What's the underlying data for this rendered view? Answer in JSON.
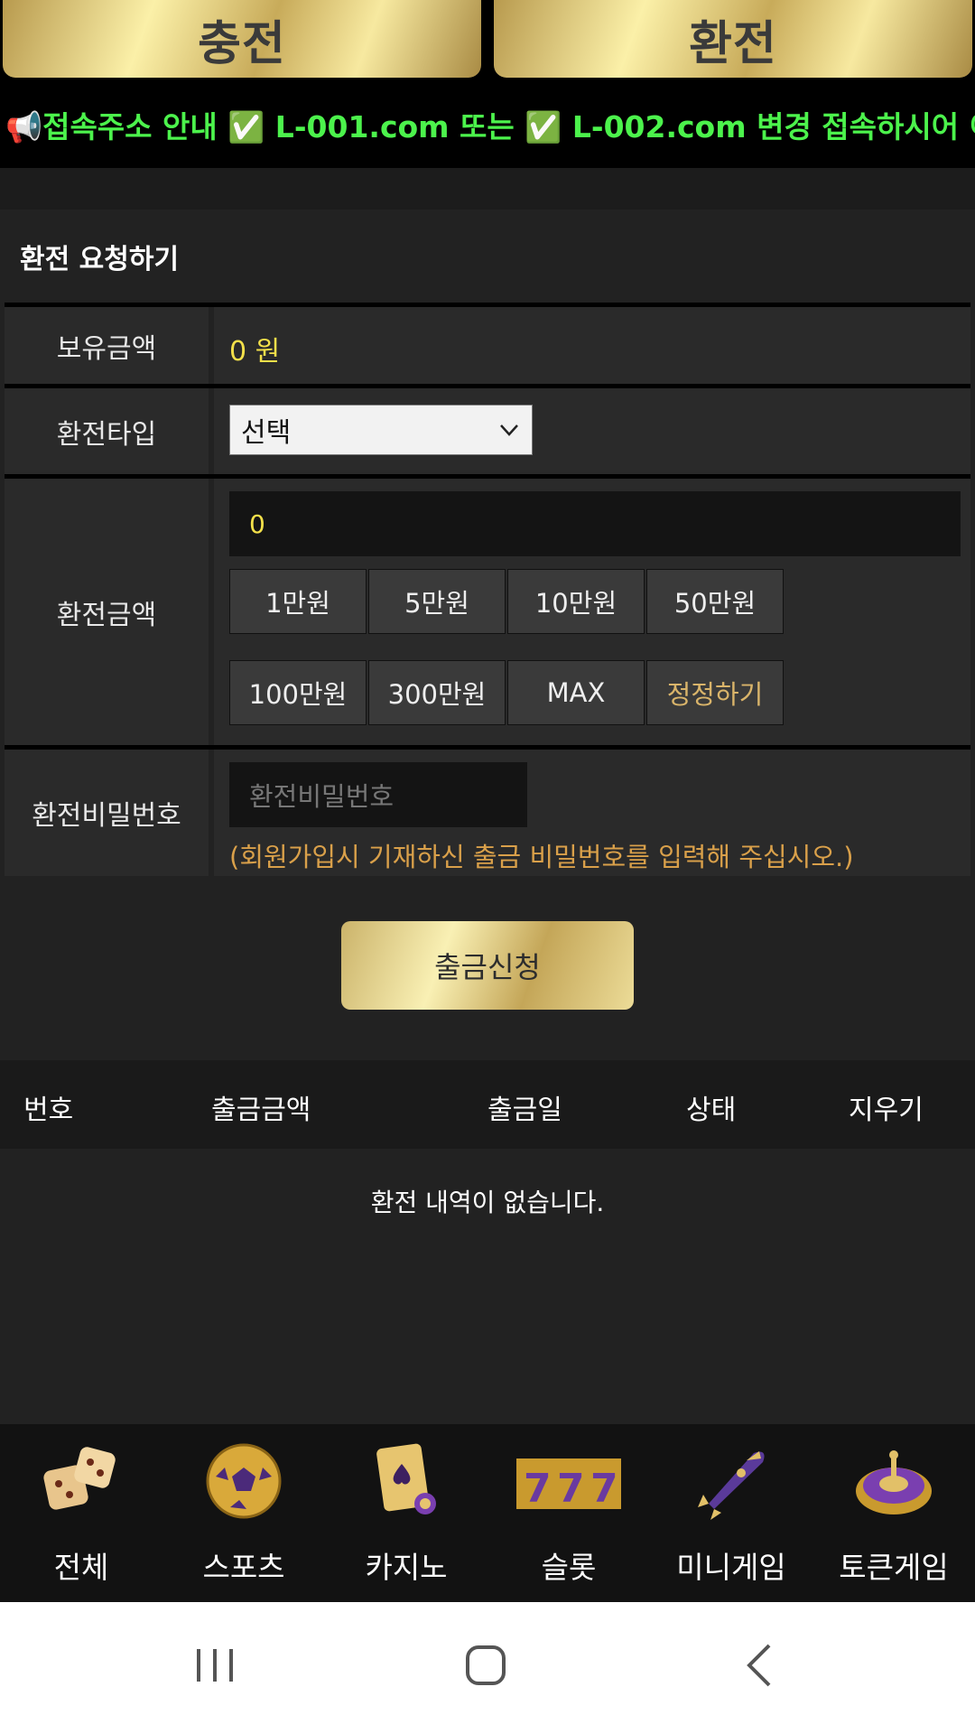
{
  "top_tabs": {
    "charge": "충전",
    "exchange": "환전"
  },
  "notice": "📢접속주소 안내 ✅ L-001.com 또는 ✅ L-002.com 변경 접속하시어 이용해 주세요",
  "form": {
    "title": "환전 요청하기",
    "balance_label": "보유금액",
    "balance_value": "0 원",
    "type_label": "환전타입",
    "type_selected": "선택",
    "amount_label": "환전금액",
    "amount_value": "0",
    "amount_buttons": [
      "1만원",
      "5만원",
      "10만원",
      "50만원",
      "100만원",
      "300만원",
      "MAX",
      "정정하기"
    ],
    "password_label": "환전비밀번호",
    "password_placeholder": "환전비밀번호",
    "password_hint": "(회원가입시 기재하신 출금 비밀번호를 입력해 주십시오.)",
    "submit": "출금신청"
  },
  "history": {
    "columns": [
      "번호",
      "출금금액",
      "출금일",
      "상태",
      "지우기"
    ],
    "empty": "환전 내역이 없습니다."
  },
  "bottom_nav": [
    {
      "label": "전체",
      "icon": "dice-icon"
    },
    {
      "label": "스포츠",
      "icon": "soccer-ball-icon"
    },
    {
      "label": "카지노",
      "icon": "playing-card-icon"
    },
    {
      "label": "슬롯",
      "icon": "slot-777-icon"
    },
    {
      "label": "미니게임",
      "icon": "rocket-icon"
    },
    {
      "label": "토큰게임",
      "icon": "roulette-icon"
    }
  ],
  "colors": {
    "gold": "#e8d48a",
    "notice_green": "#4cf34c",
    "value_yellow": "#f3e04a",
    "hint_orange": "#d9a04a"
  }
}
